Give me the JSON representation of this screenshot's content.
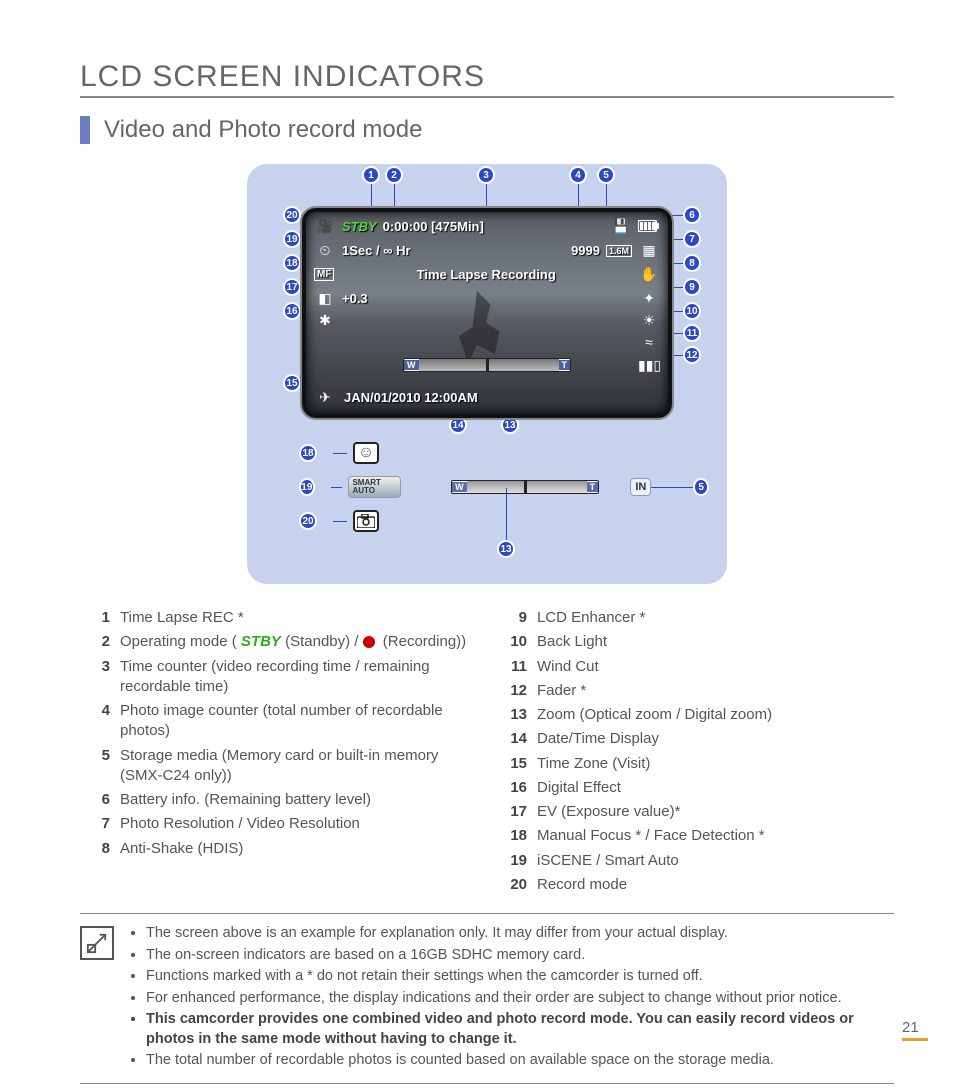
{
  "page": {
    "title": "LCD SCREEN INDICATORS",
    "subtitle": "Video and Photo record mode",
    "number": "21"
  },
  "osd": {
    "status": "STBY",
    "counter": "0:00:00 [475Min]",
    "interval": "1Sec / ∞ Hr",
    "photo_count": "9999",
    "res_badge": "1.6M",
    "mode_text": "Time Lapse Recording",
    "mf": "MF",
    "ev": "+0.3",
    "datetime": "JAN/01/2010 12:00AM",
    "zoom_w": "W",
    "zoom_t": "T",
    "storage_in": "IN"
  },
  "below": {
    "smart_auto": "SMART AUTO"
  },
  "callouts": {
    "n1": "1",
    "n2": "2",
    "n3": "3",
    "n4": "4",
    "n5": "5",
    "n6": "6",
    "n7": "7",
    "n8": "8",
    "n9": "9",
    "n10": "10",
    "n11": "11",
    "n12": "12",
    "n13": "13",
    "n14": "14",
    "n15": "15",
    "n16": "16",
    "n17": "17",
    "n18": "18",
    "n19": "19",
    "n20": "20"
  },
  "legend_left": [
    {
      "n": "1",
      "t": "Time Lapse REC *"
    },
    {
      "n": "2",
      "t_pre": "Operating mode ( ",
      "stby": "STBY",
      "t_mid": " (Standby) / ",
      "rec": " (Recording))"
    },
    {
      "n": "3",
      "t": "Time counter (video recording time / remaining recordable time)"
    },
    {
      "n": "4",
      "t": "Photo image counter (total number of recordable photos)"
    },
    {
      "n": "5",
      "t": "Storage media (Memory card or built-in memory (SMX-C24 only))"
    },
    {
      "n": "6",
      "t": "Battery info. (Remaining battery level)"
    },
    {
      "n": "7",
      "t": "Photo Resolution / Video Resolution"
    },
    {
      "n": "8",
      "t": "Anti-Shake (HDIS)"
    }
  ],
  "legend_right": [
    {
      "n": "9",
      "t": "LCD Enhancer *"
    },
    {
      "n": "10",
      "t": "Back Light"
    },
    {
      "n": "11",
      "t": "Wind Cut"
    },
    {
      "n": "12",
      "t": "Fader *"
    },
    {
      "n": "13",
      "t": "Zoom (Optical zoom / Digital zoom)"
    },
    {
      "n": "14",
      "t": "Date/Time Display"
    },
    {
      "n": "15",
      "t": "Time Zone (Visit)"
    },
    {
      "n": "16",
      "t": "Digital Effect"
    },
    {
      "n": "17",
      "t": "EV (Exposure value)*"
    },
    {
      "n": "18",
      "t": "Manual Focus * / Face Detection *"
    },
    {
      "n": "19",
      "t": "iSCENE / Smart Auto"
    },
    {
      "n": "20",
      "t": "Record mode"
    }
  ],
  "notes": [
    {
      "t": "The screen above is an example for explanation only. It may differ from your actual display."
    },
    {
      "t": "The on-screen indicators are based on a 16GB SDHC memory card."
    },
    {
      "t": "Functions marked with a * do not retain their settings when the camcorder is turned off."
    },
    {
      "t": "For enhanced performance, the display indications and their order are subject to change without prior notice."
    },
    {
      "t": "This camcorder provides one combined video and photo record mode. You can easily record videos or photos in the same mode without having to change it.",
      "bold": true
    },
    {
      "t": "The total number of recordable photos is counted based on available space on the storage media."
    }
  ]
}
